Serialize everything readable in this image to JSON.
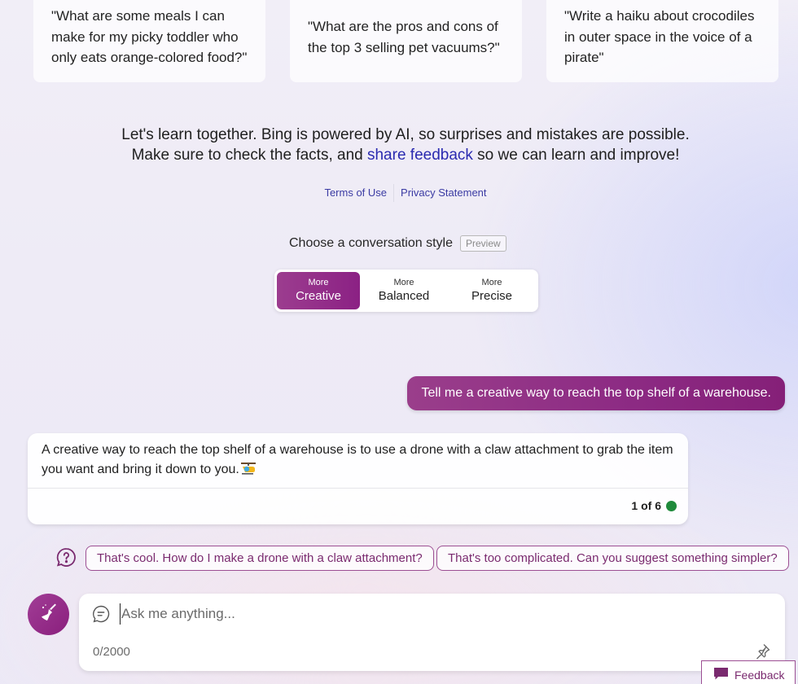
{
  "suggestions": [
    {
      "lines": [
        "\"What are some meals I can",
        "make for my picky toddler who",
        "only eats orange-colored food?\""
      ]
    },
    {
      "lines": [
        "\"What are the pros and cons of",
        "the top 3 selling pet vacuums?\""
      ]
    },
    {
      "lines": [
        "\"Write a haiku about crocodiles",
        "in outer space in the voice of a",
        "pirate\""
      ]
    }
  ],
  "disclaimer": {
    "line1": "Let's learn together. Bing is powered by AI, so surprises and mistakes are possible.",
    "line2_before": "Make sure to check the facts, and ",
    "line2_link": "share feedback",
    "line2_after": " so we can learn and improve!"
  },
  "legal": {
    "terms": "Terms of Use",
    "privacy": "Privacy Statement"
  },
  "conversation_style": {
    "heading": "Choose a conversation style",
    "badge": "Preview",
    "options": [
      {
        "prefix": "More",
        "label": "Creative",
        "active": true
      },
      {
        "prefix": "More",
        "label": "Balanced",
        "active": false
      },
      {
        "prefix": "More",
        "label": "Precise",
        "active": false
      }
    ],
    "accent_color": "#8b2184"
  },
  "chat": {
    "user_message": "Tell me a creative way to reach the top shelf of a warehouse.",
    "bot_message": "A creative way to reach the top shelf of a warehouse is to use a drone with a claw attachment to grab the item you want and bring it down to you.",
    "bot_emoji": "helicopter-emoji",
    "turn_counter": "1 of 6",
    "turn_status_color": "#1f8a3b"
  },
  "suggested_replies": [
    "That's cool. How do I make a drone with a claw attachment?",
    "That's too complicated. Can you suggest something simpler?"
  ],
  "composer": {
    "placeholder": "Ask me anything...",
    "value": "",
    "char_count": "0/2000",
    "new_topic_icon": "broom-icon",
    "pin_icon": "pin-icon"
  },
  "feedback_button": {
    "label": "Feedback"
  }
}
